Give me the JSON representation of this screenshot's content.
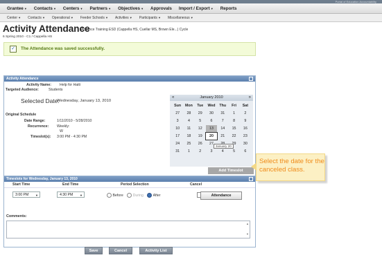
{
  "top_link": "Portal of Education Accountability",
  "nav_primary": [
    "Grantee",
    "Contacts",
    "Centers",
    "Partners",
    "Objectives",
    "Approvals",
    "Import / Export",
    "Reports"
  ],
  "nav_primary_caret": [
    true,
    true,
    true,
    true,
    true,
    false,
    true,
    false
  ],
  "nav_secondary": [
    "Center",
    "Contacts",
    "Operational",
    "Feeder Schools",
    "Activities",
    "Participants",
    "Miscellaneous"
  ],
  "header": {
    "title": "Activity Attendance",
    "description": "Advance Training ESD (Cappella HS, Cuellar MS, Brown Ele...) Cycle",
    "subtitle": "6 Spring 2010 - C1 / Cappella HS"
  },
  "success_message": "The Attendance was saved successfully.",
  "attendance_panel": {
    "title": "Activity Attendance",
    "activity_name_label": "Activity Name:",
    "activity_name": "Help for Haiti",
    "audience_label": "Targeted Audience:",
    "audience": "Students",
    "selected_date_label": "Selected Date:",
    "selected_date": "Wednesday, January 13, 2010",
    "schedule_heading": "Original Schedule",
    "date_range_label": "Date Range:",
    "date_range": "1/11/2010 - 5/28/2010",
    "recurrence_label": "Recurrence:",
    "recurrence": "Weekly:",
    "recurrence_detail": "W",
    "timeslots_label": "Timeslot(s):",
    "timeslots": "3:00 PM - 4:30 PM"
  },
  "calendar": {
    "prev": "«",
    "next": "»",
    "month": "January 2010",
    "day_headers": [
      "Sun",
      "Mon",
      "Tue",
      "Wed",
      "Thu",
      "Fri",
      "Sat"
    ],
    "weeks": [
      [
        "27",
        "28",
        "29",
        "30",
        "31",
        "1",
        "2"
      ],
      [
        "3",
        "4",
        "5",
        "6",
        "7",
        "8",
        "9"
      ],
      [
        "10",
        "11",
        "12",
        "13",
        "14",
        "15",
        "16"
      ],
      [
        "17",
        "18",
        "19",
        "20",
        "21",
        "22",
        "23"
      ],
      [
        "24",
        "25",
        "26",
        "27",
        "28",
        "29",
        "30"
      ],
      [
        "31",
        "1",
        "2",
        "3",
        "4",
        "5",
        "6"
      ]
    ],
    "tooltip": "January 20"
  },
  "add_timeslot_button": "Add Timeslot",
  "callout": "Select the date for the canceled class.",
  "timeslots_panel": {
    "title": "Timeslots for Wednesday, January 13, 2010",
    "columns": [
      "Start Time",
      "End Time",
      "Period Selection",
      "Cancel"
    ],
    "start_time": "3:00 PM",
    "end_time": "4:30 PM",
    "period_options": [
      "Before",
      "During",
      "After"
    ],
    "period_selected": "After",
    "attendance_button": "Attendance",
    "comments_label": "Comments:"
  },
  "buttons": {
    "save": "Save",
    "cancel": "Cancel",
    "activity_list": "Activity List"
  },
  "colors": {
    "panel_header": "#5b7fae",
    "success_text": "#577b16",
    "callout_text": "#ef8b1a",
    "callout_bg": "#fcf0c4"
  }
}
